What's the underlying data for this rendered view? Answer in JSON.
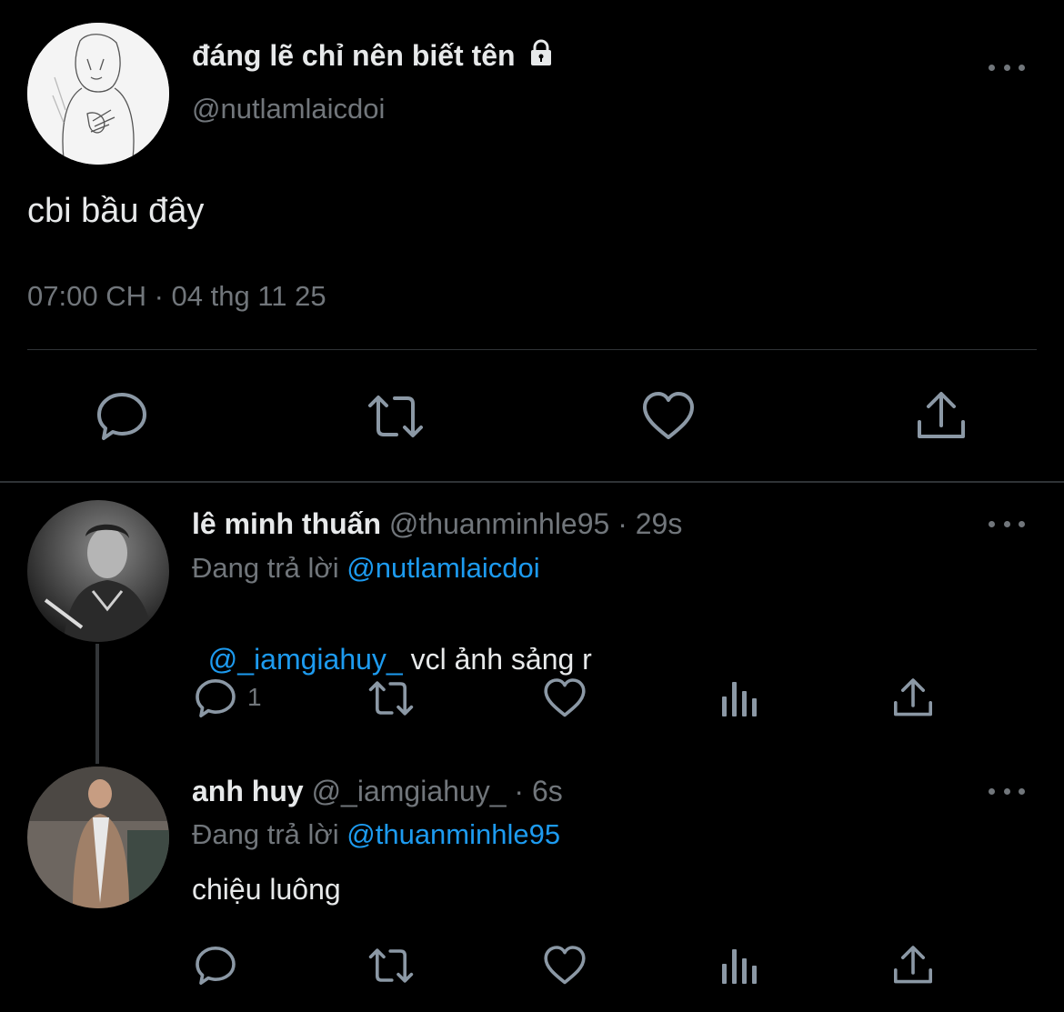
{
  "main_tweet": {
    "display_name": "đáng lẽ chỉ nên biết tên",
    "handle": "@nutlamlaicdoi",
    "text": "cbi bầu đây",
    "timestamp": "07:00 CH · 04 thg 11 25",
    "avatar": "sketch-person-avatar",
    "protected_icon": "lock-icon"
  },
  "replies": [
    {
      "display_name": "lê minh thuấn",
      "handle": "@thuanminhle95",
      "age": "· 29s",
      "replying_prefix": "Đang trả lời",
      "replying_to": "@nutlamlaicdoi",
      "mention": "@_iamgiahuy_",
      "text": " vcl ảnh sảng r",
      "reply_count": "1"
    },
    {
      "display_name": "anh huy",
      "handle": "@_iamgiahuy_",
      "age": "· 6s",
      "replying_prefix": "Đang trả lời",
      "replying_to": "@thuanminhle95",
      "text": "chiệu luông",
      "reply_count": ""
    }
  ],
  "colors": {
    "background": "#000000",
    "text": "#e7e9ea",
    "muted": "#71767b",
    "link": "#1d9bf0",
    "divider": "#2f3336"
  }
}
